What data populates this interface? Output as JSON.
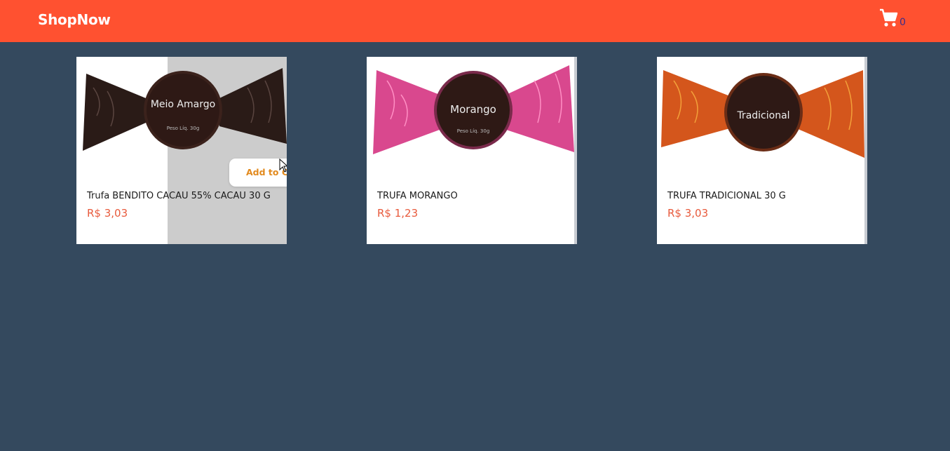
{
  "app": {
    "brand": "ShopNow",
    "cart_count": "0"
  },
  "colors": {
    "navbar": "#ff5130",
    "background": "#34495e",
    "price": "#e85a3c",
    "add_to_cart": "#e28a1e"
  },
  "products": [
    {
      "name": "Trufa BENDITO CACAU 55% CACAU 30 G",
      "price": "R$ 3,03",
      "image_label": "Meio Amargo",
      "add_label": "Add to Cart",
      "wrapper_color": "#2a1b17"
    },
    {
      "name": "TRUFA MORANGO",
      "price": "R$ 1,23",
      "image_label": "Morango",
      "wrapper_color": "#d2287a"
    },
    {
      "name": "TRUFA TRADICIONAL 30 G",
      "price": "R$ 3,03",
      "image_label": "Tradicional",
      "wrapper_color": "#d4561c"
    }
  ],
  "icons": {
    "cart": "shopping-cart-icon",
    "cursor": "mouse-cursor-icon"
  }
}
